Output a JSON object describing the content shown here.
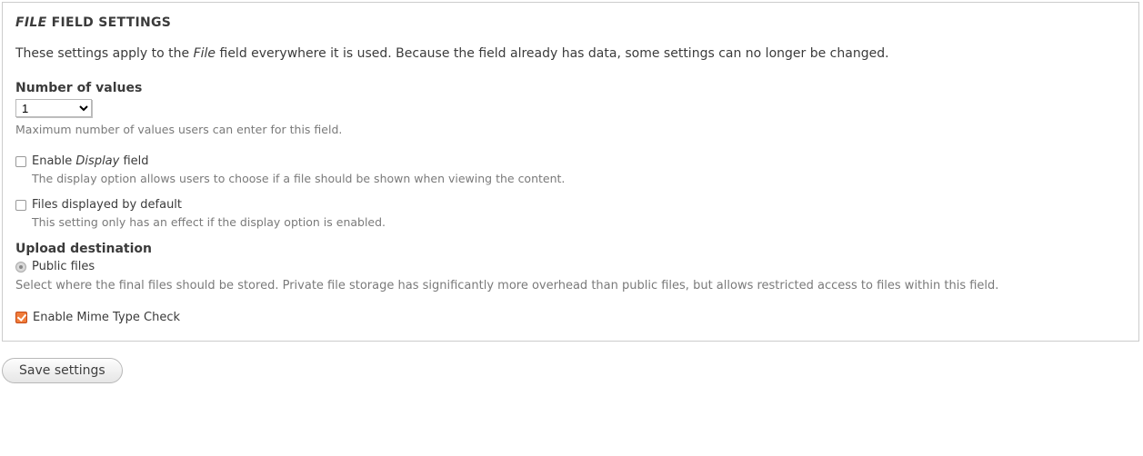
{
  "legend": {
    "prefix_italic": "File",
    "rest": " Field Settings"
  },
  "intro": {
    "before": "These settings apply to the ",
    "italic": "File",
    "after": " field everywhere it is used. Because the field already has data, some settings can no longer be changed."
  },
  "number_of_values": {
    "label": "Number of values",
    "selected": "1",
    "options": [
      "1"
    ],
    "description": "Maximum number of values users can enter for this field."
  },
  "enable_display": {
    "label_before": "Enable ",
    "label_italic": "Display",
    "label_after": " field",
    "checked": false,
    "description": "The display option allows users to choose if a file should be shown when viewing the content."
  },
  "files_default": {
    "label": "Files displayed by default",
    "checked": false,
    "description": "This setting only has an effect if the display option is enabled."
  },
  "upload_destination": {
    "heading": "Upload destination",
    "option_public": "Public files",
    "selected": "public",
    "description": "Select where the final files should be stored. Private file storage has significantly more overhead than public files, but allows restricted access to files within this field."
  },
  "enable_mime": {
    "label": "Enable Mime Type Check",
    "checked": true
  },
  "save_button": "Save settings"
}
